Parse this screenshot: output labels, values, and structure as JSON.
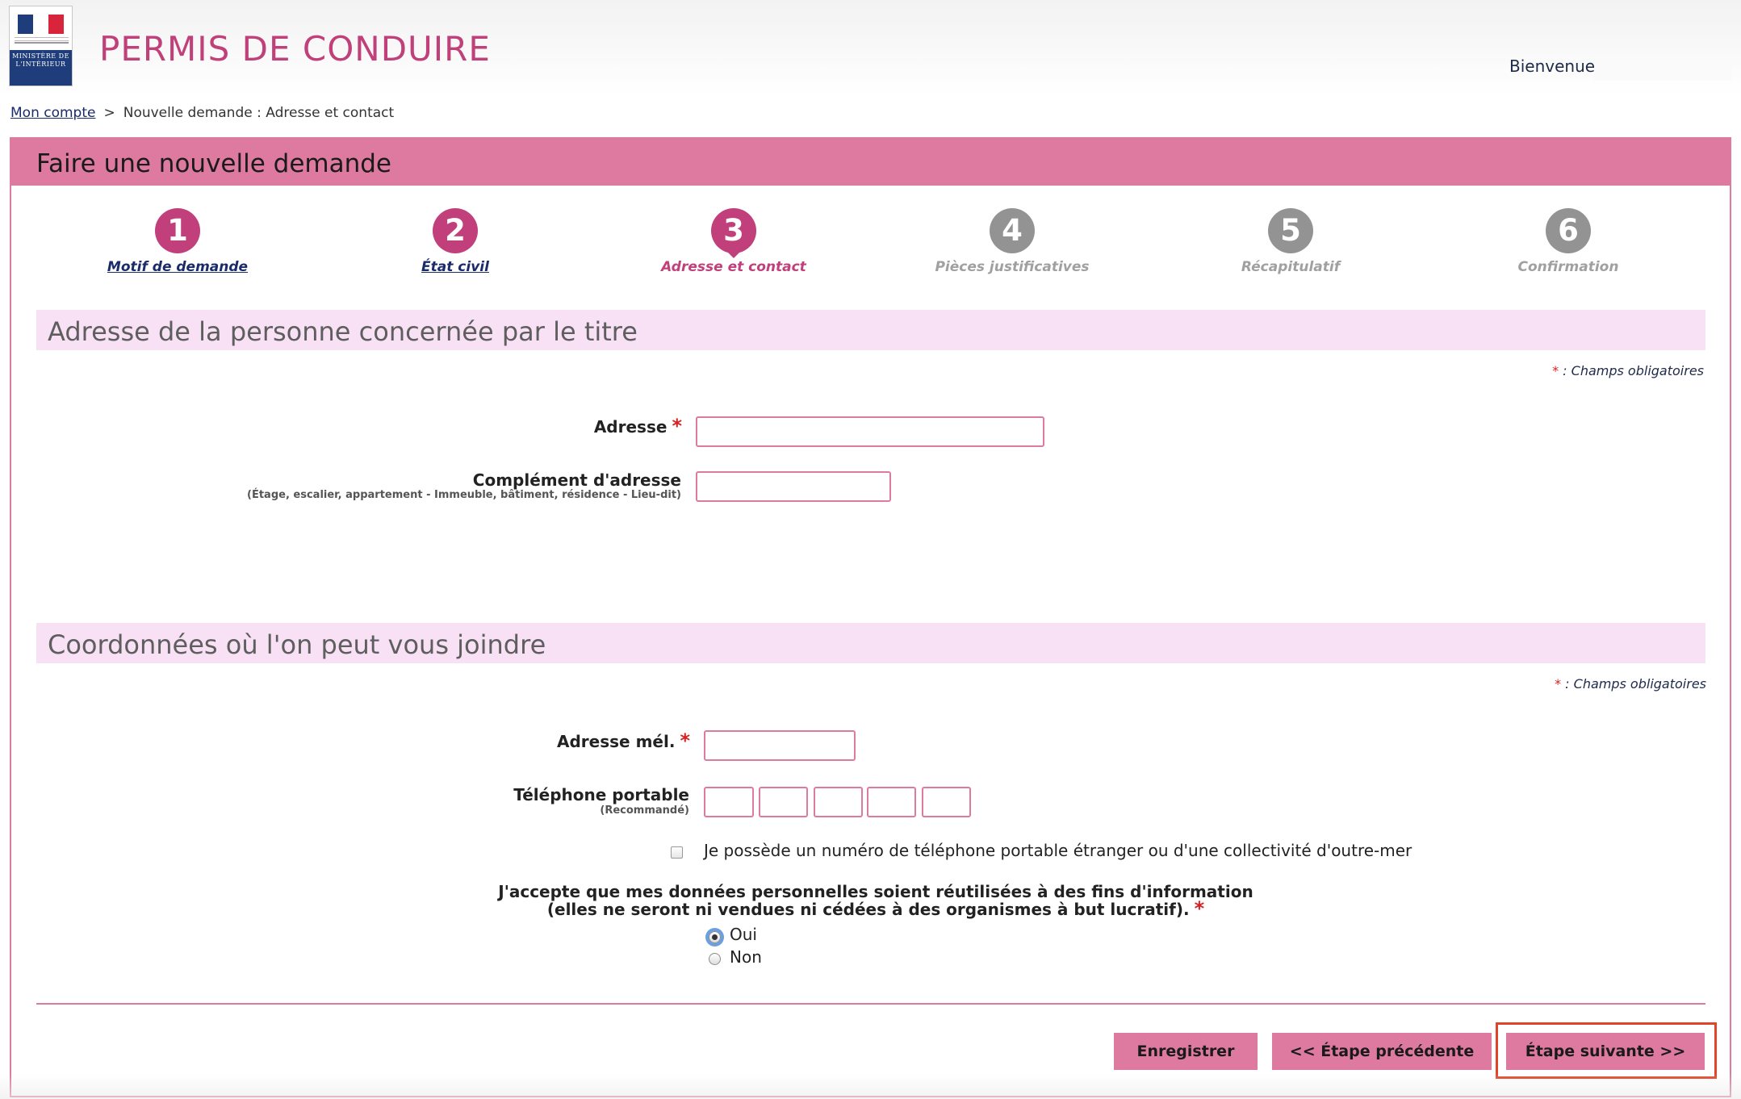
{
  "header": {
    "logo_text": "MINISTÈRE DE L'INTÉRIEUR",
    "app_title": "PERMIS DE CONDUIRE",
    "welcome": "Bienvenue"
  },
  "breadcrumb": {
    "home_link": "Mon compte",
    "separator": ">",
    "current": "Nouvelle demande : Adresse et contact"
  },
  "panel": {
    "title": "Faire une nouvelle demande"
  },
  "steps": [
    {
      "number": "1",
      "label": "Motif de demande",
      "state": "done"
    },
    {
      "number": "2",
      "label": "État civil",
      "state": "done"
    },
    {
      "number": "3",
      "label": "Adresse et contact",
      "state": "current"
    },
    {
      "number": "4",
      "label": "Pièces justificatives",
      "state": "todo"
    },
    {
      "number": "5",
      "label": "Récapitulatif",
      "state": "todo"
    },
    {
      "number": "6",
      "label": "Confirmation",
      "state": "todo"
    }
  ],
  "section_address": {
    "title": "Adresse de la personne concernée par le titre",
    "required_star": "*",
    "required_note": ": Champs obligatoires",
    "address_label": "Adresse",
    "address_value": "",
    "complement_label": "Complément d'adresse",
    "complement_hint": "(Étage, escalier, appartement - Immeuble, bâtiment, résidence - Lieu-dit)",
    "complement_value": ""
  },
  "section_contact": {
    "title": "Coordonnées où l'on peut vous joindre",
    "required_star": "*",
    "required_note": ": Champs obligatoires",
    "email_label": "Adresse mél.",
    "email_value": "",
    "phone_label": "Téléphone portable",
    "phone_hint": "(Recommandé)",
    "phone_parts": [
      "",
      "",
      "",
      "",
      ""
    ],
    "foreign_phone_label": "Je possède un numéro de téléphone portable étranger ou d'une collectivité d'outre-mer",
    "foreign_phone_checked": false,
    "consent_line1": "J'accepte que mes données personnelles soient réutilisées à des fins d'information",
    "consent_line2": "(elles ne seront ni vendues ni cédées à des organismes à but lucratif).",
    "consent_options": [
      "Oui",
      "Non"
    ],
    "consent_selected": "Oui"
  },
  "actions": {
    "save": "Enregistrer",
    "previous": "<<  Étape précédente",
    "next": "Étape suivante  >>"
  },
  "colors": {
    "brand_pink": "#de7a9f",
    "title_magenta": "#c0407a",
    "section_bg": "#f9e1f5",
    "highlight": "#e0452a"
  }
}
